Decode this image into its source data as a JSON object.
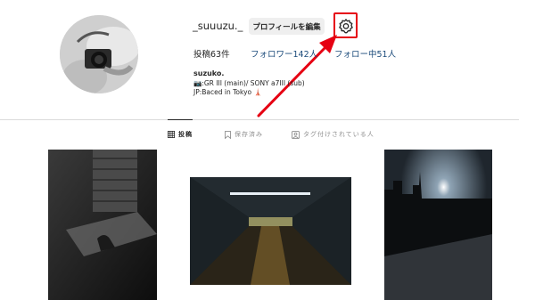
{
  "profile": {
    "username": "_suuuzu._",
    "edit_profile_label": "プロフィールを編集",
    "posts_label": "投稿63件",
    "followers_label": "フォロワー142人",
    "following_label": "フォロー中51人",
    "full_name": "suzuko.",
    "bio_line1": "📷:GR III (main)/ SONY a7III (sub)",
    "bio_line2": "JP:Baced in Tokyo 🗼"
  },
  "tabs": [
    {
      "label": "投稿",
      "icon": "grid-icon",
      "active": true
    },
    {
      "label": "保存済み",
      "icon": "bookmark-icon",
      "active": false
    },
    {
      "label": "タグ付けされている人",
      "icon": "tagged-icon",
      "active": false
    }
  ],
  "highlight_color": "#e60012"
}
